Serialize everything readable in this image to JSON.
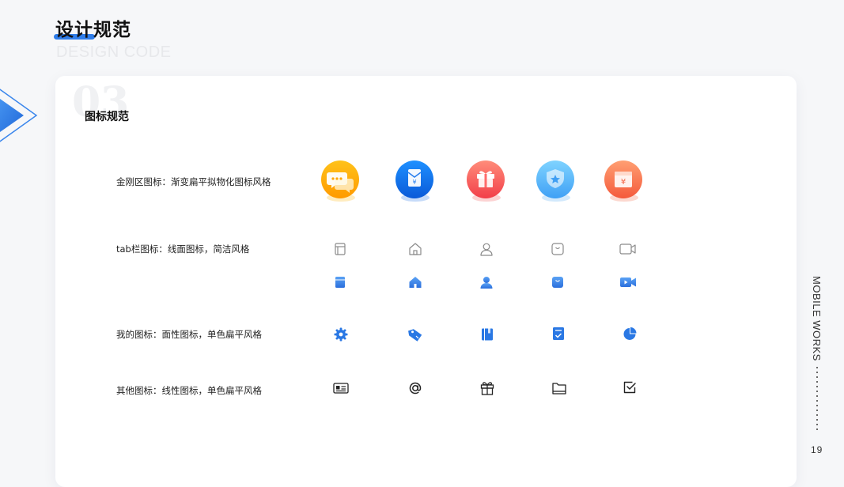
{
  "header": {
    "title": "设计规范",
    "subtitle": "DESIGN CODE"
  },
  "section": {
    "number": "03",
    "title": "图标规范"
  },
  "rows": [
    {
      "label": "金刚区图标：渐变扁平拟物化图标风格",
      "icons": [
        "chat-bubbles-icon",
        "red-envelope-icon",
        "gift-box-icon",
        "shield-star-icon",
        "coupon-yen-icon"
      ]
    },
    {
      "label": "tab栏图标：线面图标，简洁风格",
      "icons_outline": [
        "book-outline-icon",
        "home-outline-icon",
        "user-outline-icon",
        "bag-outline-icon",
        "video-outline-icon"
      ],
      "icons_filled": [
        "book-filled-icon",
        "home-filled-icon",
        "user-filled-icon",
        "bag-filled-icon",
        "video-filled-icon"
      ]
    },
    {
      "label": "我的图标：面性图标，单色扁平风格",
      "icons": [
        "gear-icon",
        "tag-icon",
        "book-icon",
        "clipboard-check-icon",
        "pie-chart-icon"
      ]
    },
    {
      "label": "其他图标：线性图标，单色扁平风格",
      "icons": [
        "id-card-icon",
        "at-sign-icon",
        "gift-outline-icon",
        "folder-icon",
        "checkbox-icon"
      ]
    }
  ],
  "sidebar": {
    "vertical_text": "MOBILE WORKS",
    "page_number": "19"
  },
  "colors": {
    "accent": "#2f7de9",
    "icon_blue": "#2a78e4",
    "line_icon": "#8a8a8a"
  }
}
